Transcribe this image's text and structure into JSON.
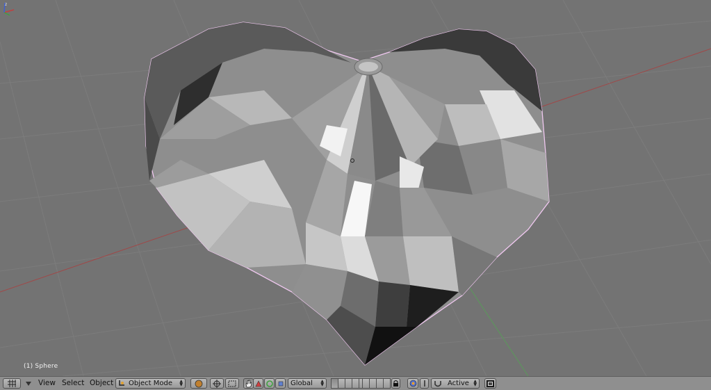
{
  "viewport": {
    "object_label": "(1) Sphere"
  },
  "header": {
    "menus": {
      "view": "View",
      "select": "Select",
      "object": "Object"
    },
    "mode": "Object Mode",
    "orientation": "Global",
    "pivot": "Active"
  },
  "icons": {
    "editor_type": "grid-icon",
    "collapse": "triangle-down-icon",
    "mode": "object-mode-icon",
    "draw_type": "solid-shading-icon",
    "pivot_point": "pivot-icon",
    "manipulator": "hand-icon",
    "translate": "triangle-icon",
    "rotate": "circle-icon",
    "scale": "square-icon",
    "lock": "lock-icon",
    "snap": "magnet-icon",
    "render": "render-icon"
  },
  "colors": {
    "viewport_bg": "#737373",
    "header_bg": "#8f8f8f",
    "selection_outline": "#f0c8f0",
    "x_axis": "#a04848",
    "y_axis": "#5a9a5a"
  }
}
